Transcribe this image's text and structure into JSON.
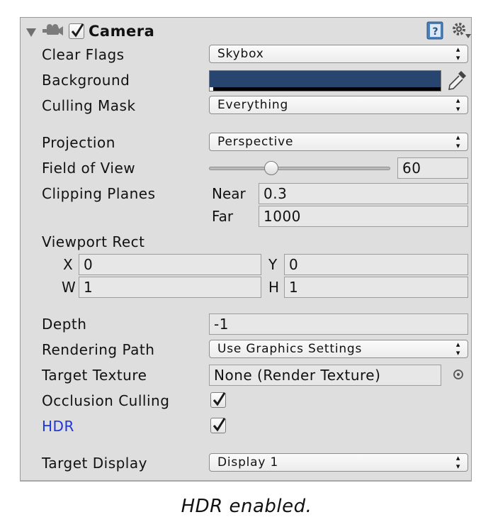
{
  "header": {
    "component_name": "Camera",
    "camera_icon": "camera-icon",
    "help_icon": "help-book-icon",
    "settings_icon": "gear-icon",
    "foldout_icon": "foldout-triangle-icon"
  },
  "fields": {
    "clear_flags": {
      "label": "Clear Flags",
      "value": "Skybox"
    },
    "background": {
      "label": "Background",
      "color": "#27456e",
      "picker_icon": "eyedropper-icon"
    },
    "culling_mask": {
      "label": "Culling Mask",
      "value": "Everything"
    },
    "projection": {
      "label": "Projection",
      "value": "Perspective"
    },
    "field_of_view": {
      "label": "Field of View",
      "value": "60",
      "slider_fraction": 0.33
    },
    "clipping_planes": {
      "label": "Clipping Planes",
      "near_label": "Near",
      "near_value": "0.3",
      "far_label": "Far",
      "far_value": "1000"
    },
    "viewport_rect": {
      "label": "Viewport Rect",
      "x_label": "X",
      "x_value": "0",
      "y_label": "Y",
      "y_value": "0",
      "w_label": "W",
      "w_value": "1",
      "h_label": "H",
      "h_value": "1"
    },
    "depth": {
      "label": "Depth",
      "value": "-1"
    },
    "rendering_path": {
      "label": "Rendering Path",
      "value": "Use Graphics Settings"
    },
    "target_texture": {
      "label": "Target Texture",
      "value": "None (Render Texture)",
      "picker_icon": "object-picker-icon"
    },
    "occlusion_culling": {
      "label": "Occlusion Culling",
      "checked": true
    },
    "hdr": {
      "label": "HDR",
      "checked": true,
      "label_color": "#1f35d9"
    },
    "target_display": {
      "label": "Target Display",
      "value": "Display 1"
    }
  },
  "caption": "HDR enabled."
}
